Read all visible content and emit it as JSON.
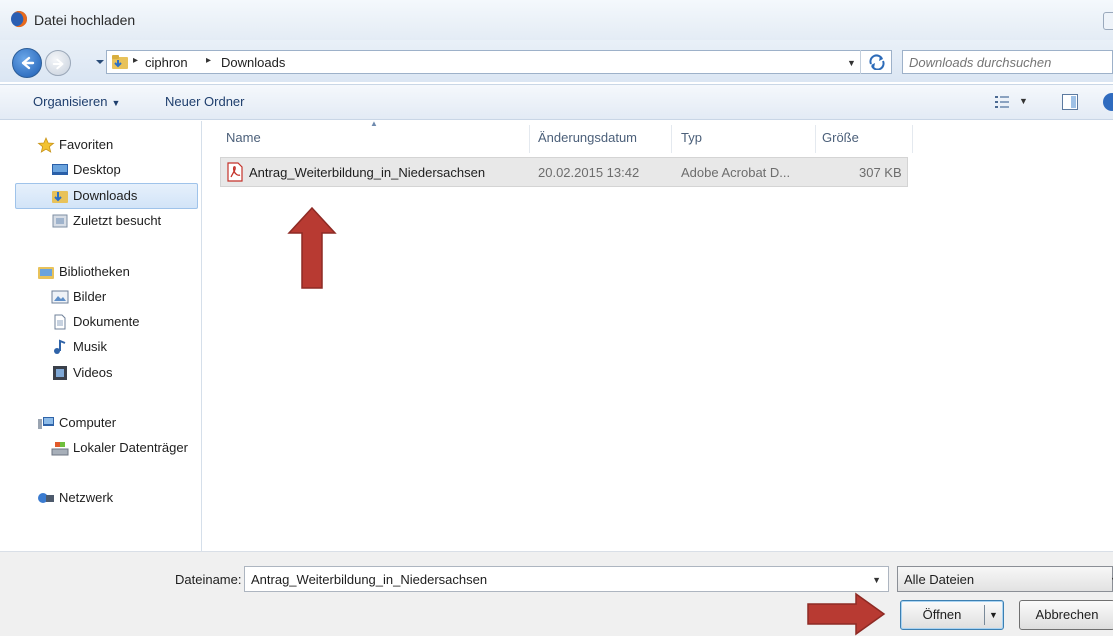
{
  "window": {
    "title": "Datei hochladen"
  },
  "navigation": {
    "breadcrumbs": [
      "ciphron",
      "Downloads"
    ],
    "search_placeholder": "Downloads durchsuchen"
  },
  "toolbar": {
    "organize_label": "Organisieren",
    "new_folder_label": "Neuer Ordner"
  },
  "sidebar": {
    "favorites": {
      "label": "Favoriten",
      "items": [
        "Desktop",
        "Downloads",
        "Zuletzt besucht"
      ]
    },
    "libraries": {
      "label": "Bibliotheken",
      "items": [
        "Bilder",
        "Dokumente",
        "Musik",
        "Videos"
      ]
    },
    "computer": {
      "label": "Computer",
      "items": [
        "Lokaler Datenträger"
      ]
    },
    "network": {
      "label": "Netzwerk"
    },
    "selected": "Downloads"
  },
  "file_list": {
    "columns": [
      "Name",
      "Änderungsdatum",
      "Typ",
      "Größe"
    ],
    "rows": [
      {
        "name": "Antrag_Weiterbildung_in_Niedersachsen",
        "date": "20.02.2015 13:42",
        "type": "Adobe Acrobat D...",
        "size": "307 KB"
      }
    ]
  },
  "footer": {
    "filename_label": "Dateiname:",
    "filename_value": "Antrag_Weiterbildung_in_Niedersachsen",
    "filetype_value": "Alle Dateien",
    "open_label": "Öffnen",
    "cancel_label": "Abbrechen"
  },
  "colors": {
    "accent": "#3c7fb1",
    "annotation_arrow": "#b83a32",
    "selection": "#e8e8e8"
  }
}
